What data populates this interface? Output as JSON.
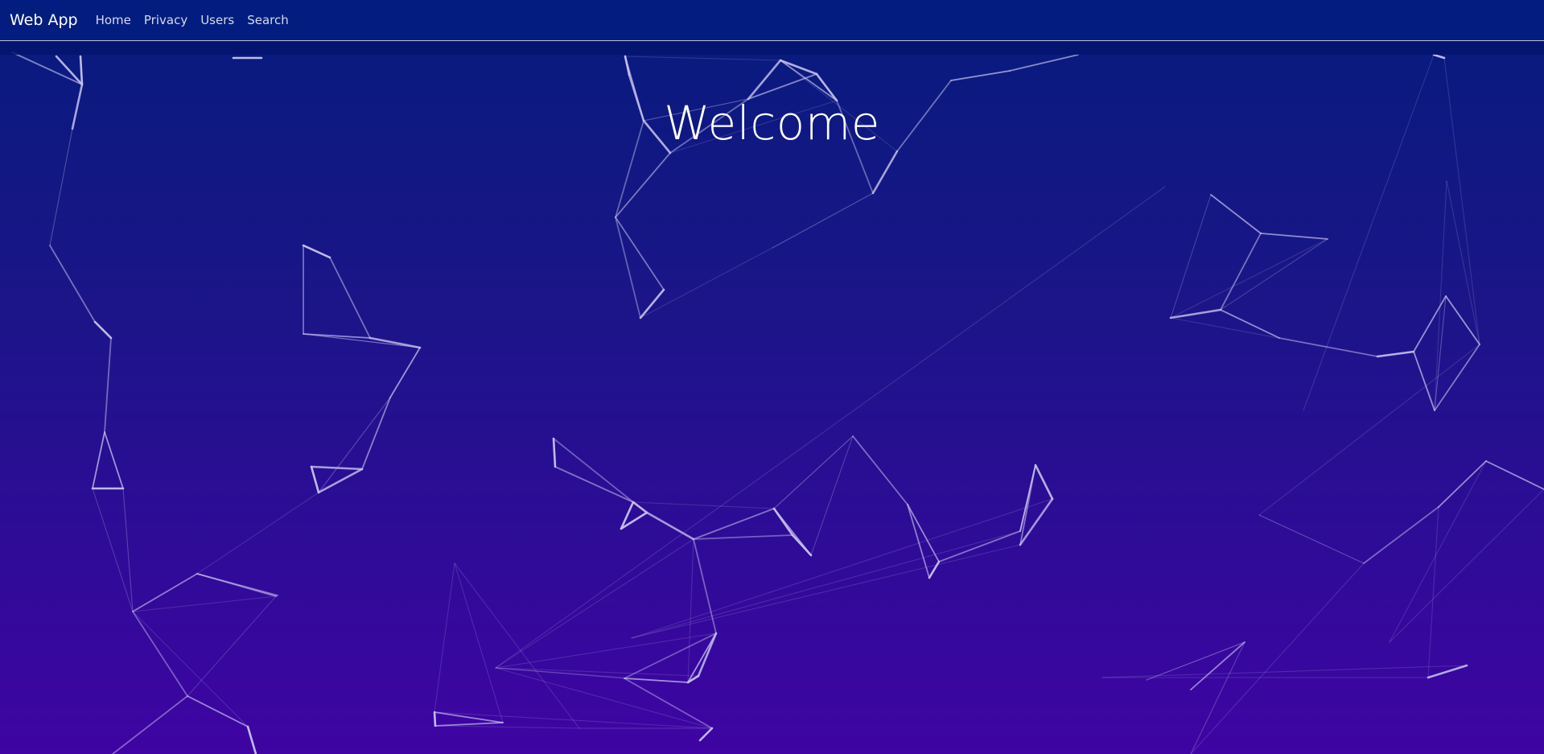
{
  "navbar": {
    "brand": "Web App",
    "links": [
      {
        "label": "Home"
      },
      {
        "label": "Privacy"
      },
      {
        "label": "Users"
      },
      {
        "label": "Search"
      }
    ]
  },
  "main": {
    "heading": "Welcome"
  },
  "colors": {
    "navbar_bg": "#021d7f",
    "gradient_top": "#061b7d",
    "gradient_bottom": "#3f04a3",
    "network_line": "#c8c3ef"
  }
}
